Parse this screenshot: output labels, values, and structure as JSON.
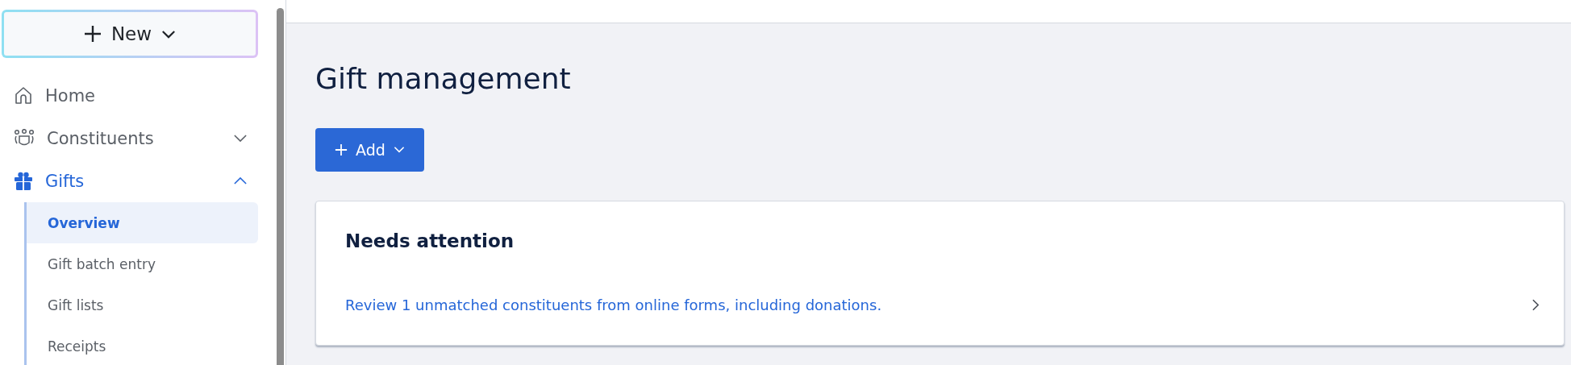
{
  "new_button": {
    "label": "New"
  },
  "sidebar": {
    "items": [
      {
        "label": "Home",
        "selected": false
      },
      {
        "label": "Constituents",
        "selected": false,
        "expanded": false
      },
      {
        "label": "Gifts",
        "selected": true,
        "expanded": true,
        "children": [
          {
            "label": "Overview",
            "selected": true
          },
          {
            "label": "Gift batch entry",
            "selected": false
          },
          {
            "label": "Gift lists",
            "selected": false
          },
          {
            "label": "Receipts",
            "selected": false
          }
        ]
      }
    ]
  },
  "page": {
    "title": "Gift management",
    "add_button": {
      "label": "Add"
    },
    "card": {
      "title": "Needs attention",
      "link": "Review 1 unmatched constituents from online forms, including donations."
    }
  }
}
